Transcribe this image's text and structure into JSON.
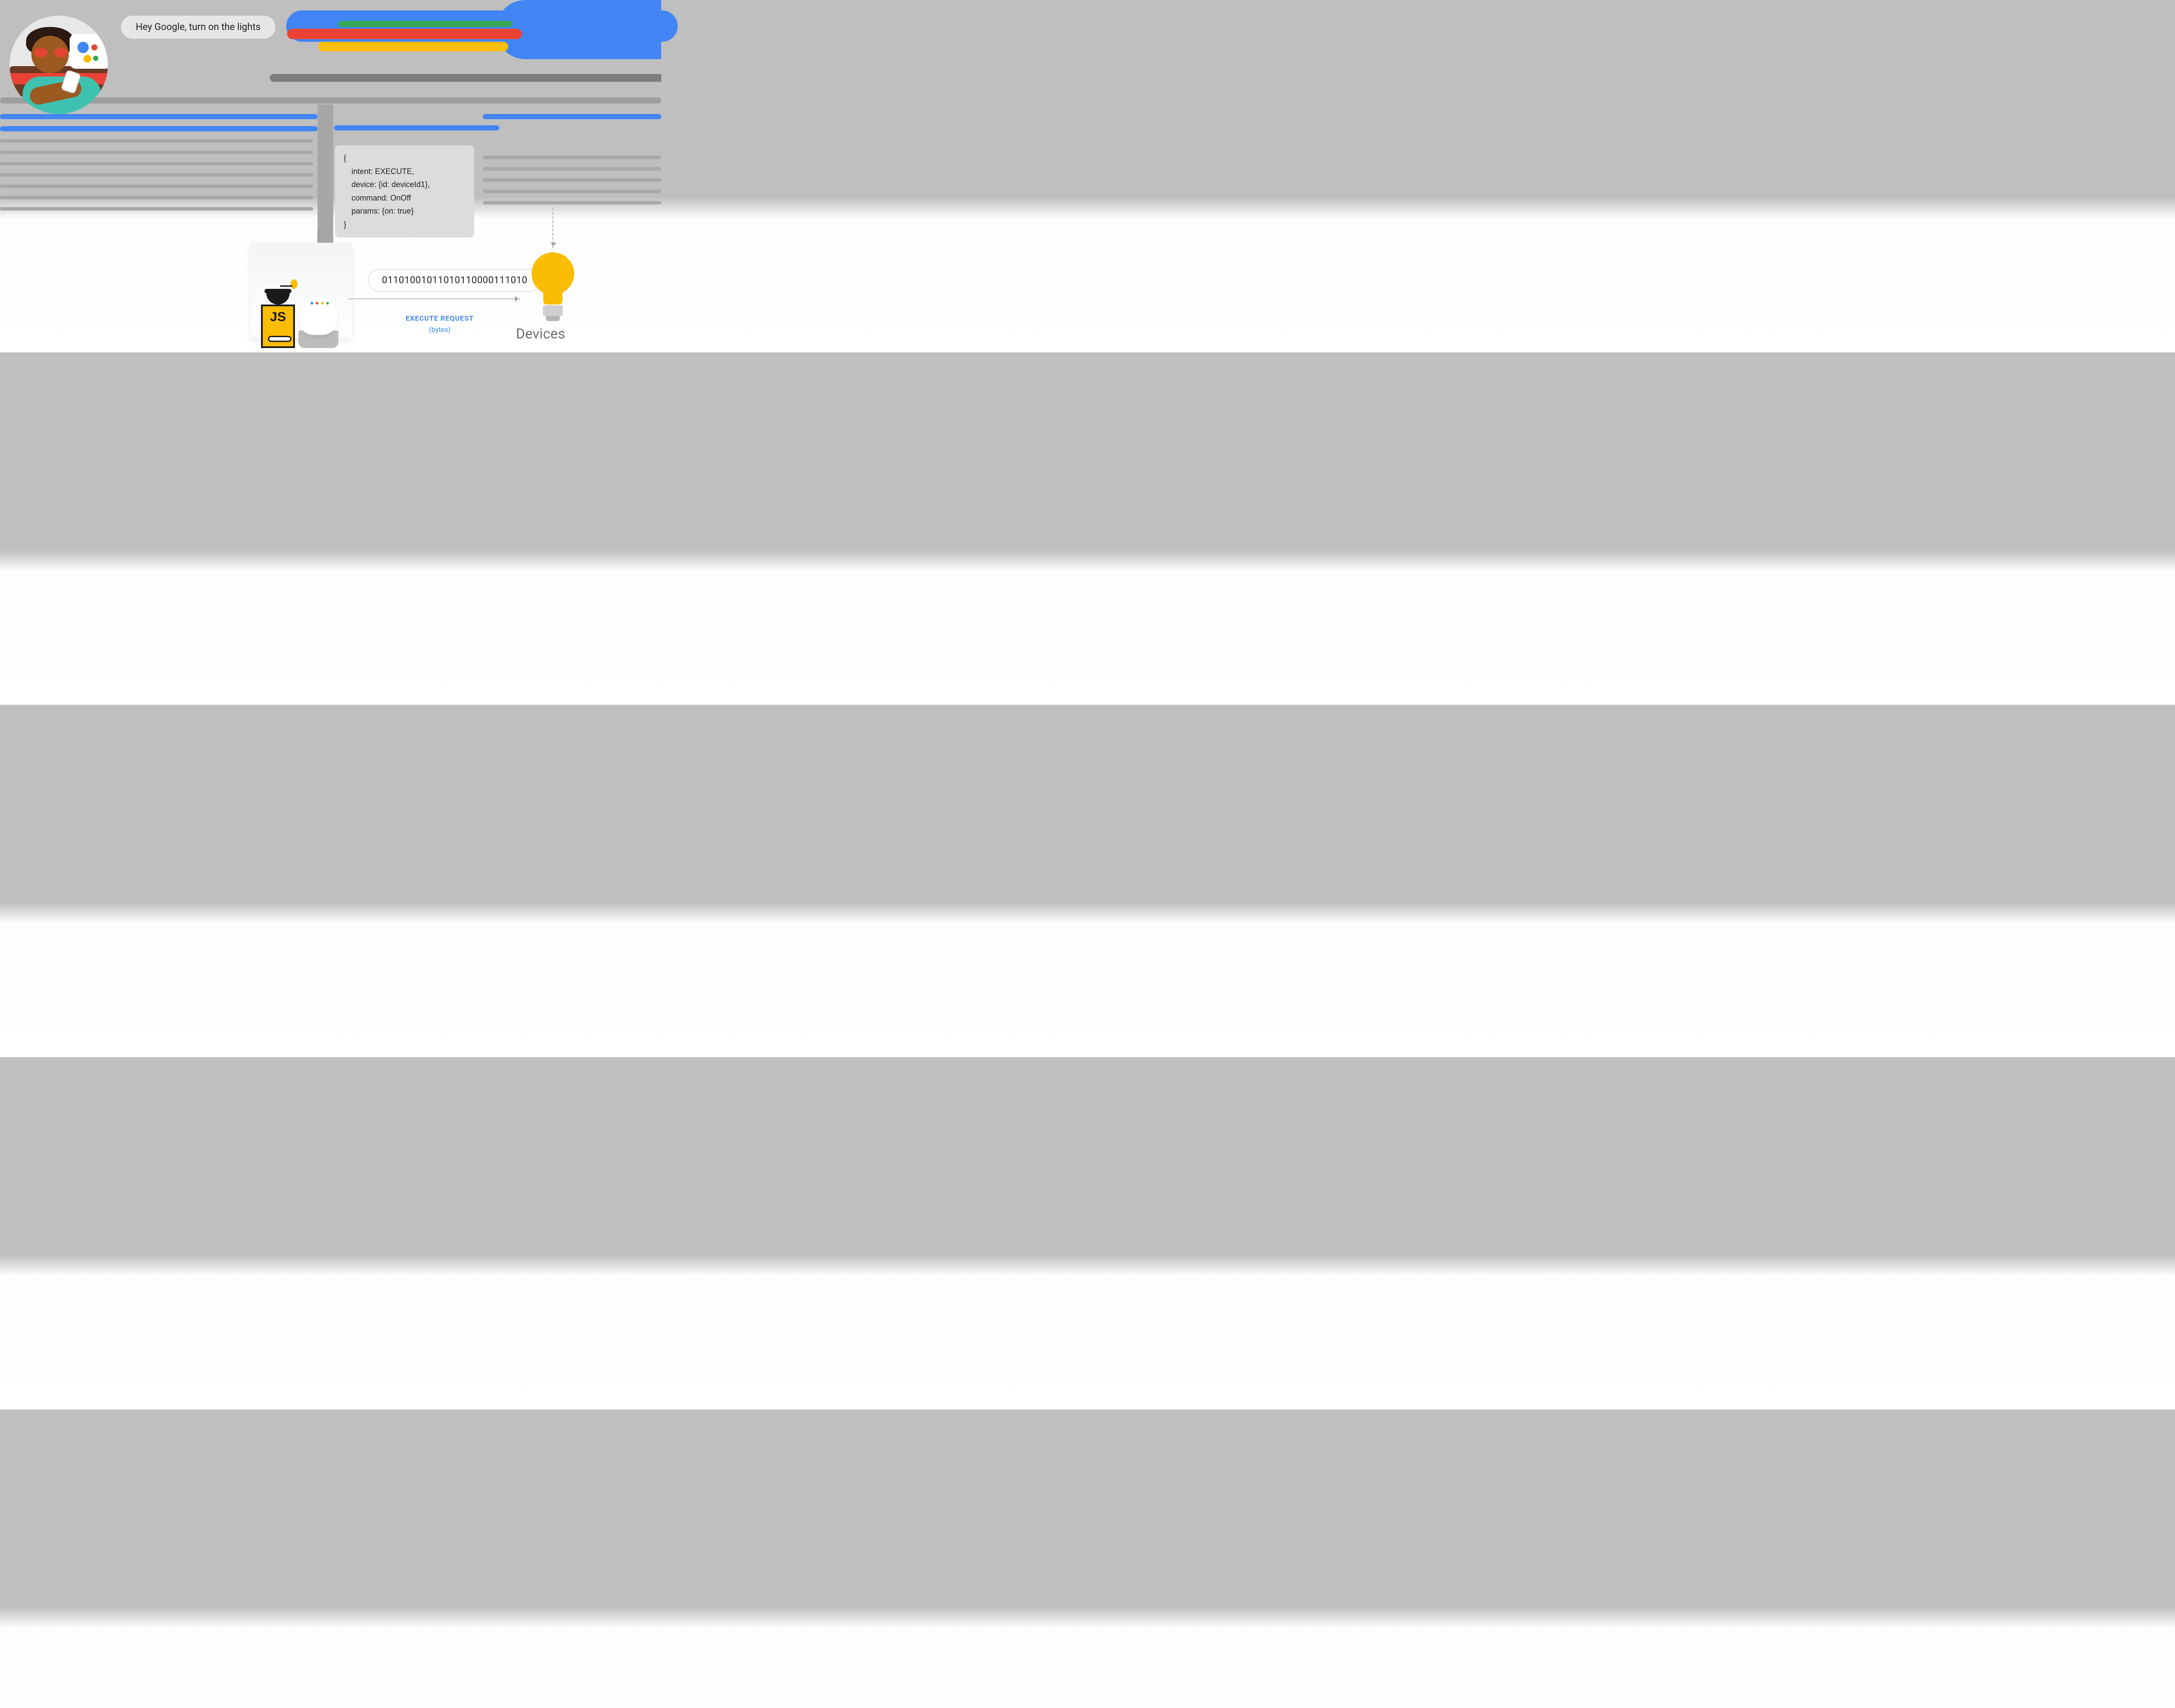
{
  "speech": {
    "text": "Hey Google, turn on the lights"
  },
  "json_payload": {
    "open": "{",
    "l1": "intent: EXECUTE,",
    "l2": "device: {id: deviceId1},",
    "l3": "command: OnOff",
    "l4": "params: {on: true}",
    "close": "}"
  },
  "grinder": {
    "label": "JS"
  },
  "bytes": {
    "value": "01101001011010110000111010"
  },
  "execute": {
    "title": "EXECUTE REQUEST",
    "subtitle": "(bytes)"
  },
  "devices": {
    "label": "Devices"
  },
  "colors": {
    "blue": "#4285f4",
    "red": "#ea4335",
    "yellow": "#fbbc04",
    "green": "#34a853",
    "grey": "#7d7d7d"
  }
}
